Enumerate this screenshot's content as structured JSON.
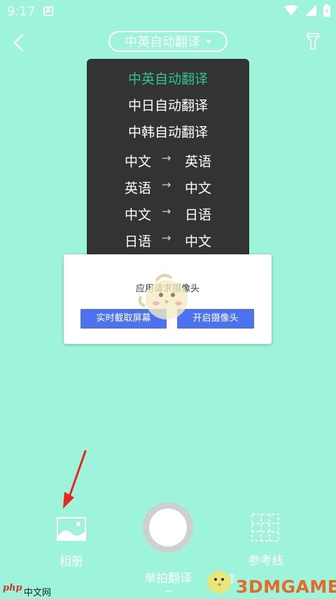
{
  "status_bar": {
    "time": "9:17",
    "badge": "A"
  },
  "header": {
    "mode_label": "中英自动翻译"
  },
  "menu": {
    "items": [
      {
        "label": "中英自动翻译",
        "active": true
      },
      {
        "label": "中日自动翻译"
      },
      {
        "label": "中韩自动翻译"
      },
      {
        "from": "中文",
        "to": "英语"
      },
      {
        "from": "英语",
        "to": "中文"
      },
      {
        "from": "中文",
        "to": "日语"
      },
      {
        "from": "日语",
        "to": "中文"
      }
    ],
    "arrow": "→"
  },
  "dialog": {
    "message": "应用请求摄像头",
    "screen_button": "实时截取屏幕",
    "camera_button": "开启摄像头"
  },
  "bottom": {
    "album_label": "相册",
    "shoot_label": "单拍翻译",
    "guide_label": "参考线",
    "behind_label": "翻译"
  },
  "watermarks": {
    "php": "php",
    "php_cn": "中文网",
    "game": "3DMGAME"
  },
  "colors": {
    "background": "#9df4da",
    "menu_bg": "#333333",
    "active": "#2fc48f",
    "dialog_button": "#4c72f0",
    "annotation": "#e8261c"
  },
  "icons": [
    "back-arrow-icon",
    "caret-down-icon",
    "flashlight-icon",
    "album-icon",
    "grid-guide-icon",
    "wifi-icon",
    "signal-icon",
    "battery-icon"
  ]
}
